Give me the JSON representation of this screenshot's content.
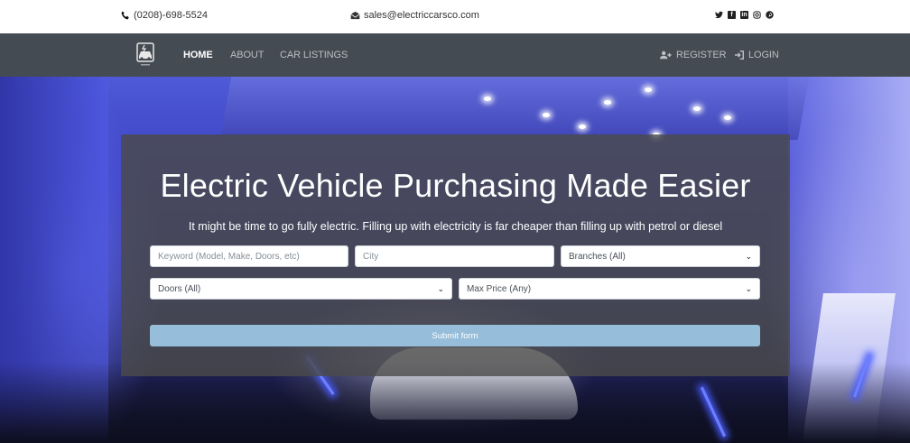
{
  "topbar": {
    "phone": "(0208)-698-5524",
    "email": "sales@electriccarsco.com",
    "social_icons": [
      "twitter-icon",
      "facebook-icon",
      "linkedin-icon",
      "instagram-icon",
      "pinterest-icon"
    ]
  },
  "navbar": {
    "logo_icon": "car-logo-icon",
    "links": [
      {
        "label": "HOME",
        "active": true
      },
      {
        "label": "ABOUT",
        "active": false
      },
      {
        "label": "CAR LISTINGS",
        "active": false
      }
    ],
    "register": "REGISTER",
    "login": "LOGIN"
  },
  "hero": {
    "title": "Electric Vehicle Purchasing Made Easier",
    "subtitle": "It might be time to go fully electric. Filling up with electricity is far cheaper than filling up with petrol or diesel"
  },
  "form": {
    "keyword_placeholder": "Keyword (Model, Make, Doors, etc)",
    "city_placeholder": "City",
    "branches": "Branches (All)",
    "doors": "Doors (All)",
    "max_price": "Max Price (Any)",
    "submit": "Submit form"
  },
  "colors": {
    "navbar_bg": "#454b52",
    "submit_bg": "#96bdd9",
    "panel_bg": "#4a4a4a"
  }
}
